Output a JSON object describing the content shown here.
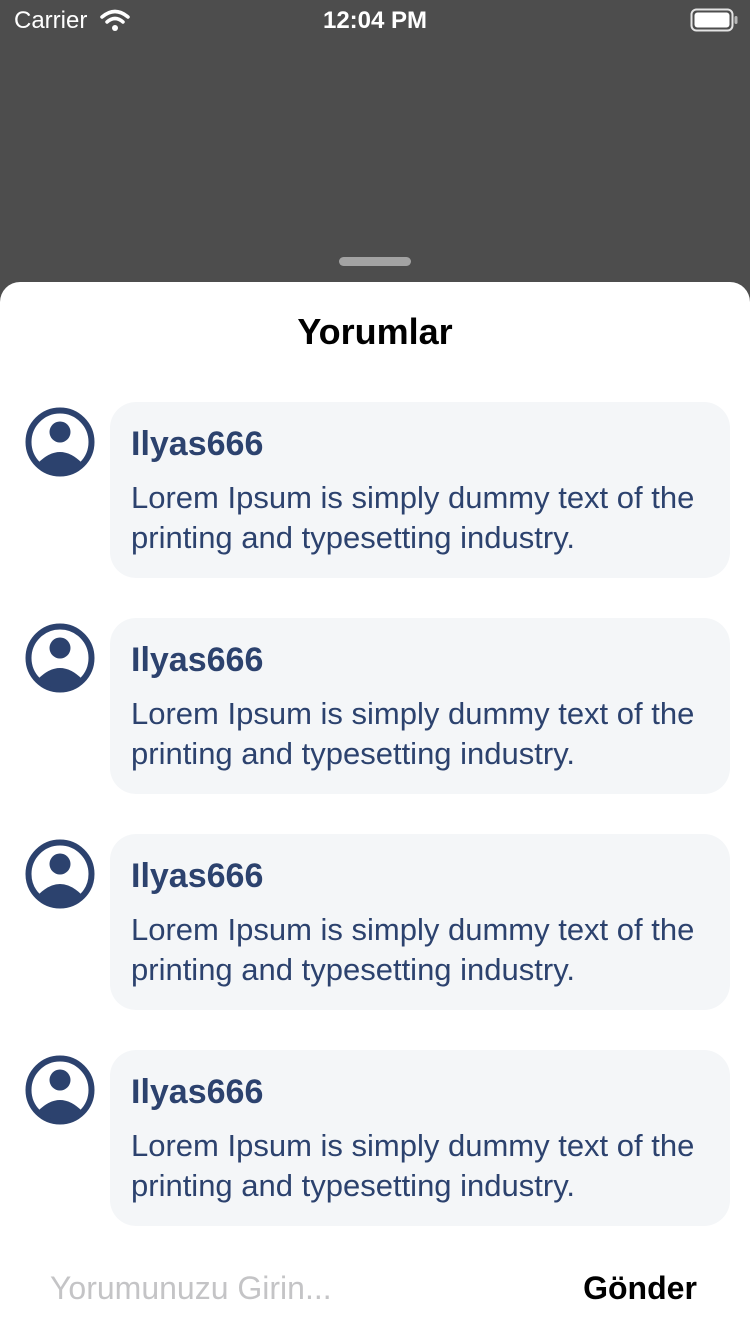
{
  "status_bar": {
    "carrier": "Carrier",
    "time": "12:04 PM",
    "icons": [
      "wifi-icon",
      "battery-icon"
    ]
  },
  "sheet": {
    "title": "Yorumlar"
  },
  "comments": [
    {
      "username": "Ilyas666",
      "text": "Lorem Ipsum is simply dummy text of the printing and typesetting industry.",
      "avatar_icon": "user-avatar-icon"
    },
    {
      "username": "Ilyas666",
      "text": "Lorem Ipsum is simply dummy text of the printing and typesetting industry.",
      "avatar_icon": "user-avatar-icon"
    },
    {
      "username": "Ilyas666",
      "text": "Lorem Ipsum is simply dummy text of the printing and typesetting industry.",
      "avatar_icon": "user-avatar-icon"
    },
    {
      "username": "Ilyas666",
      "text": "Lorem Ipsum is simply dummy text of the printing and typesetting industry.",
      "avatar_icon": "user-avatar-icon"
    }
  ],
  "composer": {
    "value": "",
    "placeholder": "Yorumunuzu Girin...",
    "send_label": "Gönder"
  },
  "colors": {
    "overlay": "#4d4d4d",
    "sheet_background": "#ffffff",
    "bubble_background": "#f4f6f8",
    "accent_navy": "#2c426e",
    "placeholder": "#c4c4c6"
  }
}
